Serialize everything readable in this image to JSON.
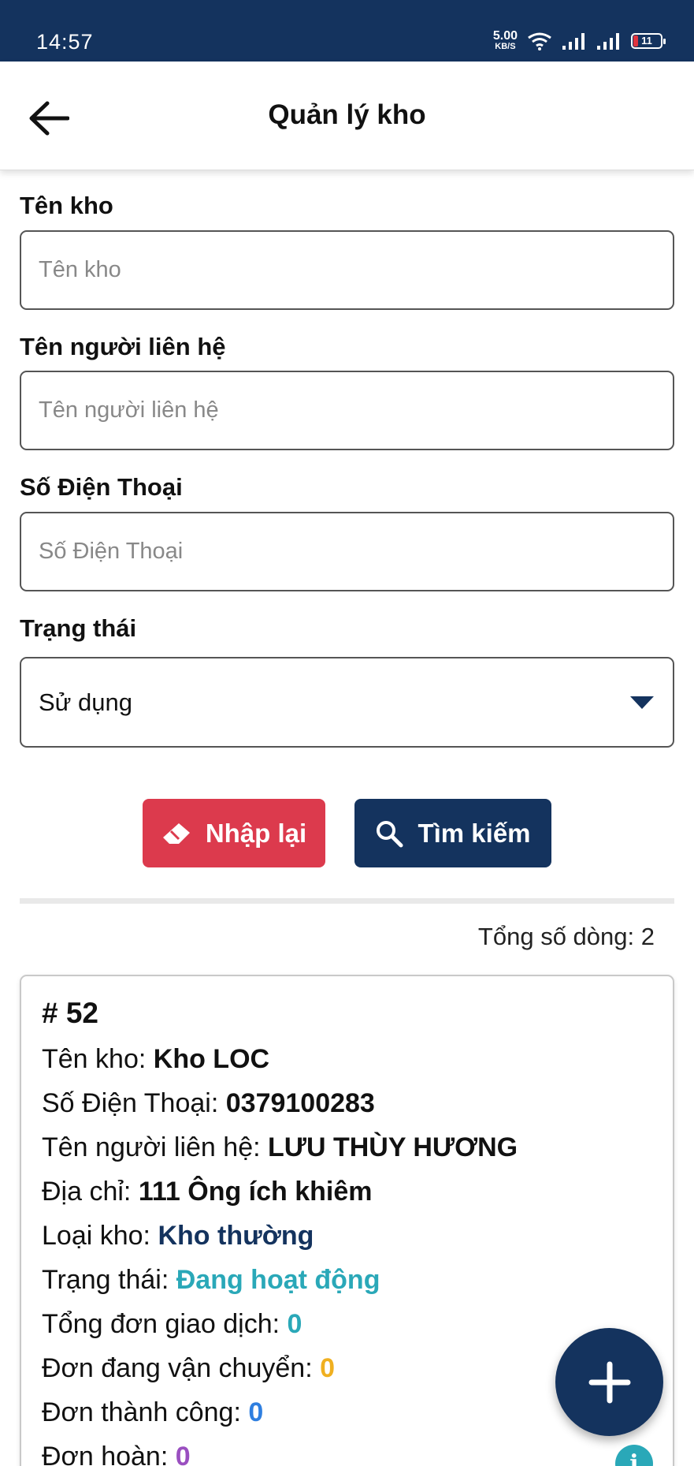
{
  "status_bar": {
    "time": "14:57",
    "net_speed_value": "5.00",
    "net_speed_unit": "KB/S",
    "battery_level": "11"
  },
  "app_bar": {
    "title": "Quản lý kho",
    "back_icon": "arrow-left-icon"
  },
  "form": {
    "warehouse_name": {
      "label": "Tên kho",
      "placeholder": "Tên kho",
      "value": ""
    },
    "contact_name": {
      "label": "Tên người liên hệ",
      "placeholder": "Tên người liên hệ",
      "value": ""
    },
    "phone": {
      "label": "Số Điện Thoại",
      "placeholder": "Số Điện Thoại",
      "value": ""
    },
    "status": {
      "label": "Trạng thái",
      "selected": "Sử dụng"
    }
  },
  "buttons": {
    "reset_label": "Nhập lại",
    "reset_icon": "eraser-icon",
    "search_label": "Tìm kiếm",
    "search_icon": "search-icon"
  },
  "results": {
    "total_label": "Tổng số dòng:",
    "total_value": "2"
  },
  "card": {
    "id": "# 52",
    "rows": [
      {
        "label": "Tên kho:",
        "value": "Kho LOC"
      },
      {
        "label": "Số Điện Thoại:",
        "value": "0379100283"
      },
      {
        "label": "Tên người liên hệ:",
        "value": "LƯU THÙY HƯƠNG"
      },
      {
        "label": "Địa chỉ:",
        "value": "111 Ông ích khiêm"
      },
      {
        "label": "Loại kho:",
        "value": "Kho thường"
      },
      {
        "label": "Trạng thái:",
        "value": "Đang hoạt động"
      },
      {
        "label": "Tổng đơn giao dịch:",
        "value": "0"
      },
      {
        "label": "Đơn đang vận chuyển:",
        "value": "0"
      },
      {
        "label": "Đơn thành công:",
        "value": "0"
      },
      {
        "label": "Đơn hoàn:",
        "value": "0"
      }
    ]
  },
  "fab": {
    "icon": "plus-icon"
  },
  "info_button": {
    "icon": "info-icon",
    "glyph": "i"
  },
  "colors": {
    "primary": "#14335e",
    "danger": "#dc3a4d",
    "active_status": "#2aa8b8",
    "warehouse_type": "#14335e",
    "total_orders": "#2aa8b8",
    "in_transit": "#f0b020",
    "success": "#2f7fe0",
    "returned": "#9a4fc0"
  }
}
